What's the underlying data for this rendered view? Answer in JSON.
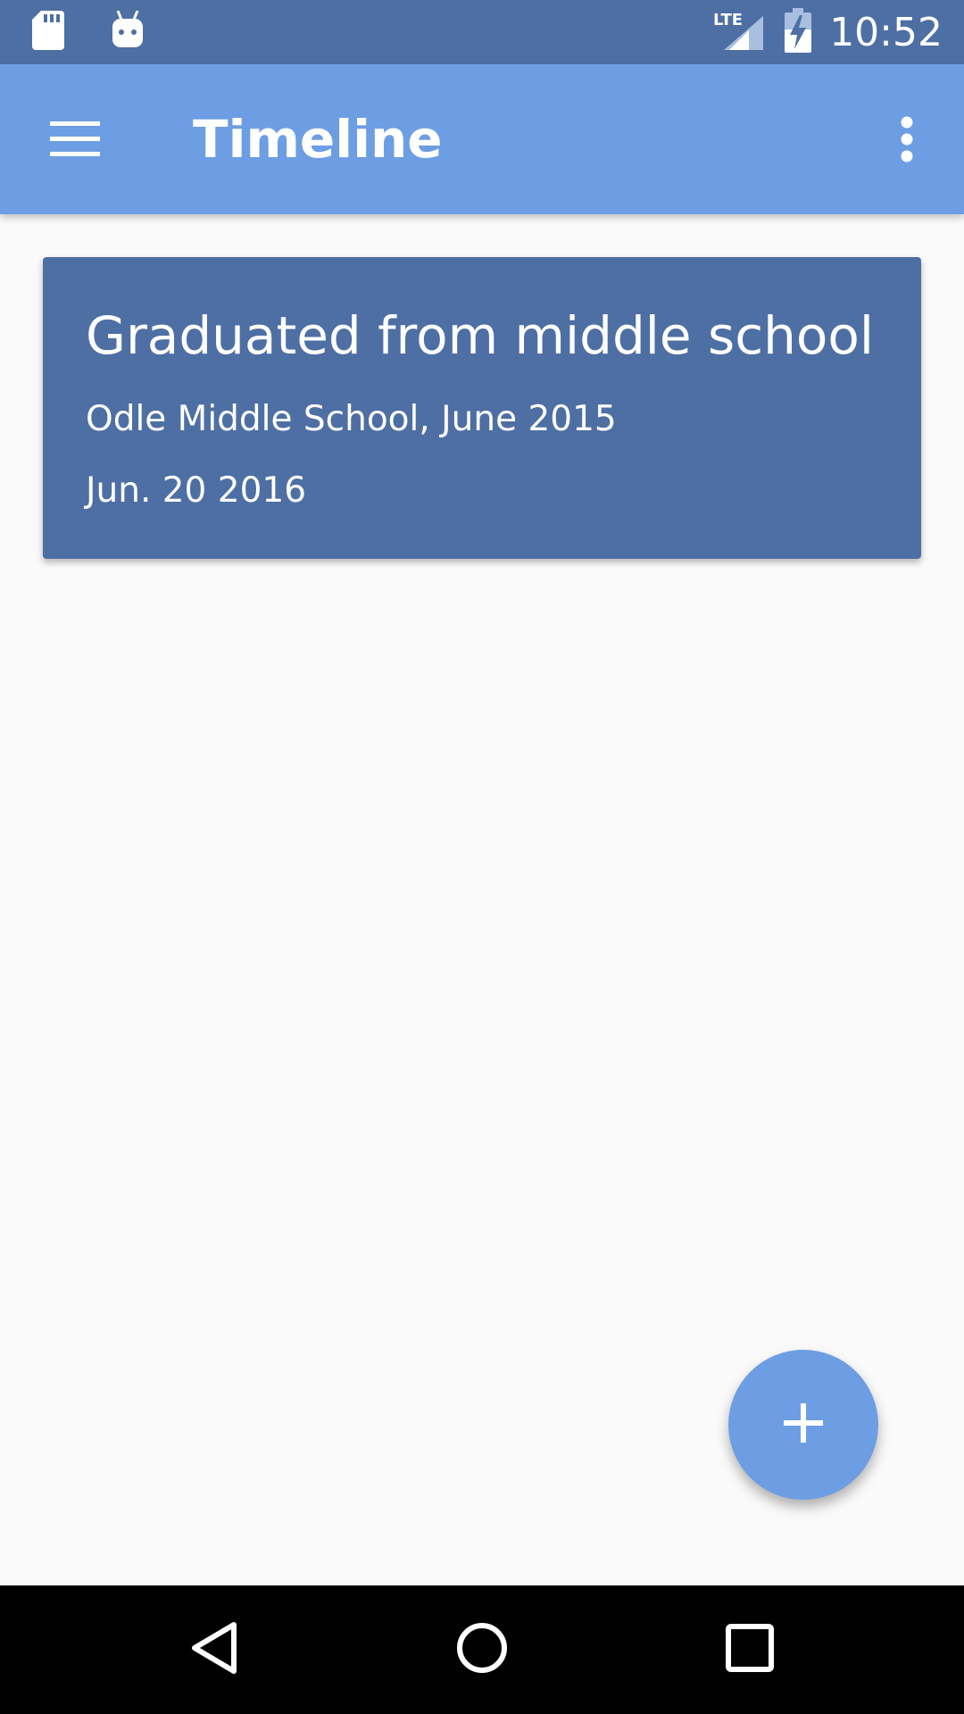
{
  "status_bar": {
    "time": "10:52",
    "icons": [
      "sd-card-icon",
      "android-debug-icon",
      "lte-signal-icon",
      "battery-charging-icon"
    ],
    "network_label": "LTE"
  },
  "app_bar": {
    "title": "Timeline",
    "menu_icon": "hamburger-menu-icon",
    "overflow_icon": "more-vert-icon"
  },
  "timeline": {
    "entries": [
      {
        "title": "Graduated from middle school",
        "subtitle": "Odle Middle School, June 2015",
        "date": "Jun. 20 2016"
      }
    ]
  },
  "fab": {
    "icon": "add-icon"
  },
  "nav_bar": {
    "buttons": [
      "back-icon",
      "home-icon",
      "recents-icon"
    ]
  },
  "colors": {
    "status_bar": "#4e6fa3",
    "app_bar": "#6d9ee3",
    "card": "#4e6fa3",
    "fab": "#6d9ee3",
    "background": "#fafafa",
    "nav_bar": "#000000"
  }
}
